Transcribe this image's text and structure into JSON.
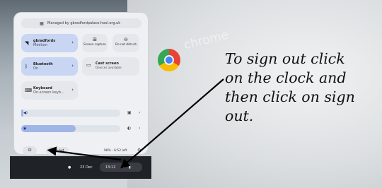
{
  "background": {
    "chrome_label": "chrome"
  },
  "annotation": {
    "text": "To sign out click\non the clock and\nthen click on sign\nout."
  },
  "panel": {
    "managed_by": "Managed by gbradfordpalace.hool.org.uk",
    "tiles": {
      "network": {
        "title": "gbradfords",
        "subtitle": "Medium",
        "icon": "wifi-icon"
      },
      "screen_capture": {
        "label": "Screen capture",
        "icon": "screen-capture-icon"
      },
      "do_not_disturb": {
        "label": "Do not disturb",
        "icon": "do-not-disturb-icon"
      },
      "bluetooth": {
        "title": "Bluetooth",
        "subtitle": "On",
        "icon": "bluetooth-icon"
      },
      "cast": {
        "title": "Cast screen",
        "subtitle": "Devices available",
        "icon": "cast-icon"
      },
      "keyboard": {
        "title": "Keyboard",
        "subtitle": "On-screen keyb...",
        "icon": "keyboard-icon"
      }
    },
    "volume_level": 0.02,
    "brightness_level": 0.55,
    "sign_out_label": "Sign out",
    "battery": "98% - 6:52 left"
  },
  "shelf": {
    "date": "23 Dec",
    "time": "13:12"
  },
  "colors": {
    "tile_active": "#c8d5f3",
    "tile_inactive": "#e4e7ec",
    "annotation_arrow": "#000000"
  }
}
